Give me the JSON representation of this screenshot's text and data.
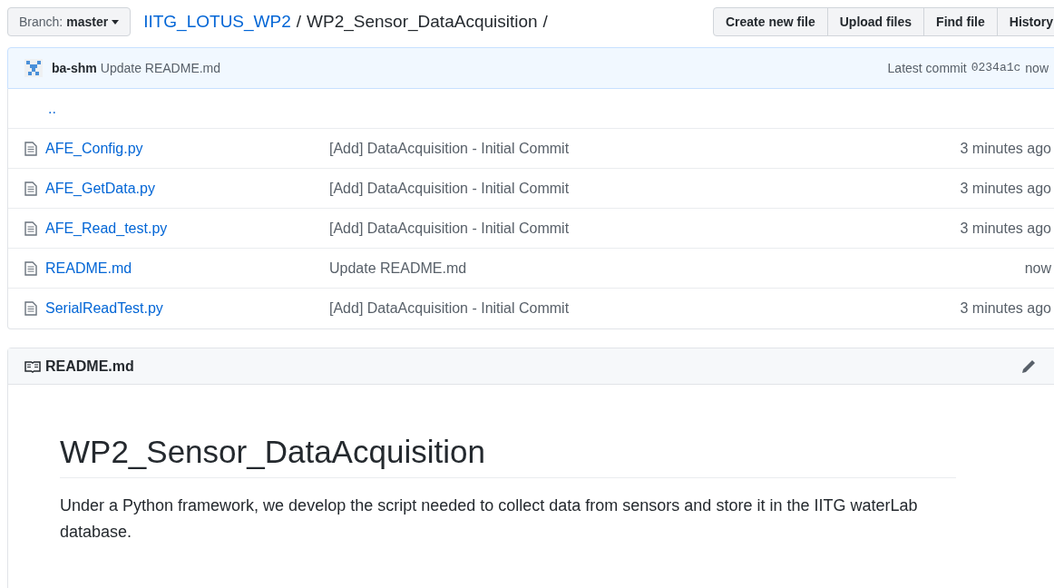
{
  "branch": {
    "label": "Branch:",
    "name": "master"
  },
  "breadcrumb": {
    "repo": "IITG_LOTUS_WP2",
    "separator": "/",
    "folder": "WP2_Sensor_DataAcquisition",
    "trailing": "/"
  },
  "actions": [
    "Create new file",
    "Upload files",
    "Find file",
    "History"
  ],
  "commit": {
    "author": "ba-shm",
    "message": "Update README.md",
    "label": "Latest commit",
    "sha": "0234a1c",
    "age": "now"
  },
  "parent_link": "..",
  "files": [
    {
      "name": "AFE_Config.py",
      "message": "[Add] DataAcquisition - Initial Commit",
      "age": "3 minutes ago"
    },
    {
      "name": "AFE_GetData.py",
      "message": "[Add] DataAcquisition - Initial Commit",
      "age": "3 minutes ago"
    },
    {
      "name": "AFE_Read_test.py",
      "message": "[Add] DataAcquisition - Initial Commit",
      "age": "3 minutes ago"
    },
    {
      "name": "README.md",
      "message": "Update README.md",
      "age": "now"
    },
    {
      "name": "SerialReadTest.py",
      "message": "[Add] DataAcquisition - Initial Commit",
      "age": "3 minutes ago"
    }
  ],
  "readme": {
    "filename": "README.md",
    "heading": "WP2_Sensor_DataAcquisition",
    "body": "Under a Python framework, we develop the script needed to collect data from sensors and store it in the IITG waterLab database."
  }
}
